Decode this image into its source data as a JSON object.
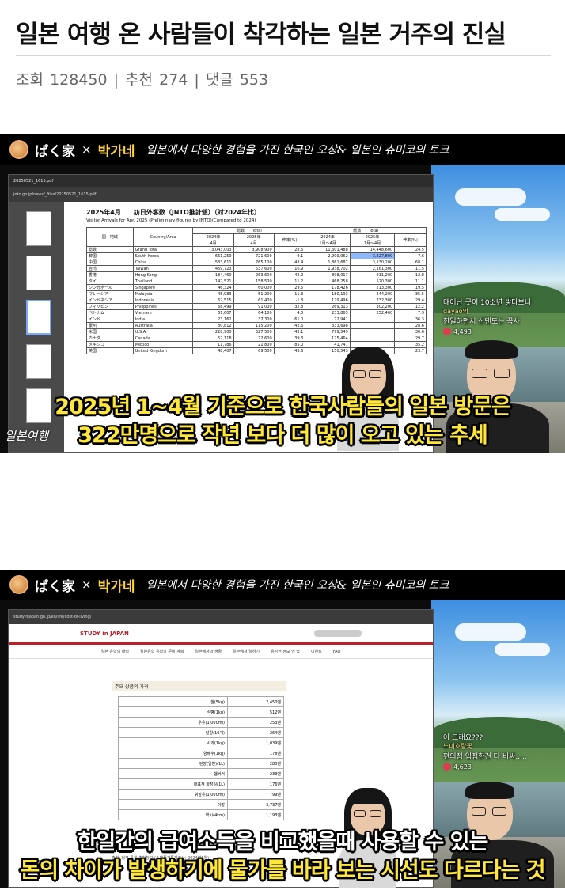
{
  "post": {
    "title": "일본 여행 온 사람들이 착각하는 일본 거주의 진실",
    "views_label": "조회",
    "views": "128450",
    "recommend_label": "추천",
    "recommend": "274",
    "comments_label": "댓글",
    "comments": "553",
    "separator": "|"
  },
  "channel": {
    "brand_japanese": "ぱく家",
    "brand_x": "×",
    "brand_korean": "박가네",
    "tagline": "일본에서 다양한 경험을 가진 한국인 오상& 일본인 츄미코의 토크"
  },
  "frame1": {
    "pdf_tab": "20250521_1615.pdf",
    "pdf_url": "jnto.go.jp/news/_files/20250521_1615.pdf",
    "doc_heading": "2025年4月　　訪日外客数（JNTO推計値）（対2024年比）",
    "doc_subheading": "Visitor Arrivals for Apr. 2025 (Preliminary figures by JNTO)(Compared to 2024)",
    "table": {
      "h_region": "国・地域",
      "h_country": "Country/Area",
      "h_total_month": "総数　　Total",
      "h_total_ytd": "総数　　Total",
      "h_2024_apr": "2024年",
      "h_2025_apr": "2025年",
      "h_growth": "伸率(%)",
      "h_2024_ytd": "2024年",
      "h_2025_ytd": "2025年",
      "h_growth2": "伸率(%)",
      "sub_apr": "4月",
      "sub_ytd": "1月～4月",
      "rows": [
        [
          "総数",
          "Grand Total",
          "3,043,003",
          "3,908,900",
          "28.5",
          "11,601,488",
          "14,448,600",
          "24.5"
        ],
        [
          "韓国",
          "South Korea",
          "661,259",
          "721,600",
          "9.1",
          "2,999,962",
          "3,227,800",
          "7.6"
        ],
        [
          "中国",
          "China",
          "533,611",
          "765,100",
          "43.4",
          "1,861,687",
          "3,130,200",
          "68.1"
        ],
        [
          "台湾",
          "Taiwan",
          "459,723",
          "537,600",
          "16.9",
          "1,938,702",
          "2,161,300",
          "11.5"
        ],
        [
          "香港",
          "Hong Kong",
          "184,460",
          "263,600",
          "42.9",
          "808,017",
          "911,200",
          "12.8"
        ],
        [
          "タイ",
          "Thailand",
          "142,521",
          "158,500",
          "11.2",
          "468,258",
          "520,300",
          "11.1"
        ],
        [
          "シンガポール",
          "Singapore",
          "46,324",
          "60,000",
          "29.5",
          "178,426",
          "213,300",
          "19.5"
        ],
        [
          "マレーシア",
          "Malaysia",
          "45,983",
          "51,200",
          "11.3",
          "180,193",
          "244,200",
          "35.5"
        ],
        [
          "インドネシア",
          "Indonesia",
          "62,515",
          "61,400",
          "-1.8",
          "179,496",
          "232,300",
          "29.4"
        ],
        [
          "フィリピン",
          "Philippines",
          "68,499",
          "91,000",
          "32.8",
          "269,313",
          "302,200",
          "12.2"
        ],
        [
          "ベトナム",
          "Vietnam",
          "61,607",
          "64,100",
          "4.0",
          "233,865",
          "252,400",
          "7.9"
        ],
        [
          "インド",
          "India",
          "23,162",
          "37,300",
          "61.0",
          "72,941",
          "",
          "36.3"
        ],
        [
          "豪州",
          "Australia",
          "80,812",
          "115,200",
          "42.6",
          "333,698",
          "",
          "28.6"
        ],
        [
          "米国",
          "U.S.A.",
          "228,900",
          "327,500",
          "43.1",
          "799,549",
          "",
          "30.6"
        ],
        [
          "カナダ",
          "Canada",
          "52,118",
          "72,600",
          "39.3",
          "175,464",
          "",
          "29.7"
        ],
        [
          "メキシコ",
          "Mexico",
          "11,786",
          "21,800",
          "85.0",
          "41,747",
          "",
          "35.2"
        ],
        [
          "英国",
          "United Kingdom",
          "48,407",
          "69,500",
          "43.6",
          "150,543",
          "",
          "23.7"
        ]
      ]
    },
    "chat_user": "dayao의",
    "chat_line1": "태어난 곳이 10소년 쌓다보니",
    "chat_line2": "한일하면서 산댄도는 꼭사",
    "chat_likes": "4,493",
    "caption_line1": "2025년 1~4월 기준으로 한국사람들의 일본 방문은",
    "caption_line2": "322만명으로 작년 보다 더 많이 오고 있는 추세",
    "side_tag": "일본여행"
  },
  "frame2": {
    "site_url": "studyinjapan.go.jp/ko/life/cost-of-living/",
    "site_logo": "STUDY in JAPAN",
    "nav": [
      "일본 유학의 매력",
      "일본유학 유학의 준비 계획",
      "일본에서의 생활",
      "일본에서 일하기",
      "유익한 정보 앤 팁",
      "이벤트",
      "FAQ"
    ],
    "section_title": "주요 상품의 가격",
    "prices": [
      [
        "쌀(5kg)",
        "2,450엔"
      ],
      [
        "식빵(1kg)",
        "512엔"
      ],
      [
        "우유(1,000ml)",
        "253엔"
      ],
      [
        "달걀(10개)",
        "264엔"
      ],
      [
        "사과(1kg)",
        "1,039엔"
      ],
      [
        "양배추(1kg)",
        "178엔"
      ],
      [
        "된장(일반)(1L)",
        "280엔"
      ],
      [
        "햄버거",
        "233엔"
      ],
      [
        "대표적 화장실(1L)",
        "176엔"
      ],
      [
        "휘발유(1,000ml)",
        "799엔"
      ],
      [
        "이발",
        "3,737엔"
      ],
      [
        "택시(4km)",
        "1,193엔"
      ]
    ],
    "source": "출처: 정부 통계 총합창구 (소매물가통계조사: 2024년6월)",
    "chat_line0": "아 그래요???",
    "chat_user": "노미호랑꽃",
    "chat_line2": "편의점 입점한건 다 비싸.....",
    "chat_likes": "4,623",
    "caption_line1": "한일간의 급여소득을 비교했을때 사용할 수 있는",
    "caption_line2": "돈의 차이가 발생하기에 물가를 바라 보는 시선도 다르다는 것"
  },
  "colors": {
    "caption_yellow": "#ffe63a",
    "brand_red": "#b8202a",
    "highlight_blue": "#8fb8ff"
  }
}
